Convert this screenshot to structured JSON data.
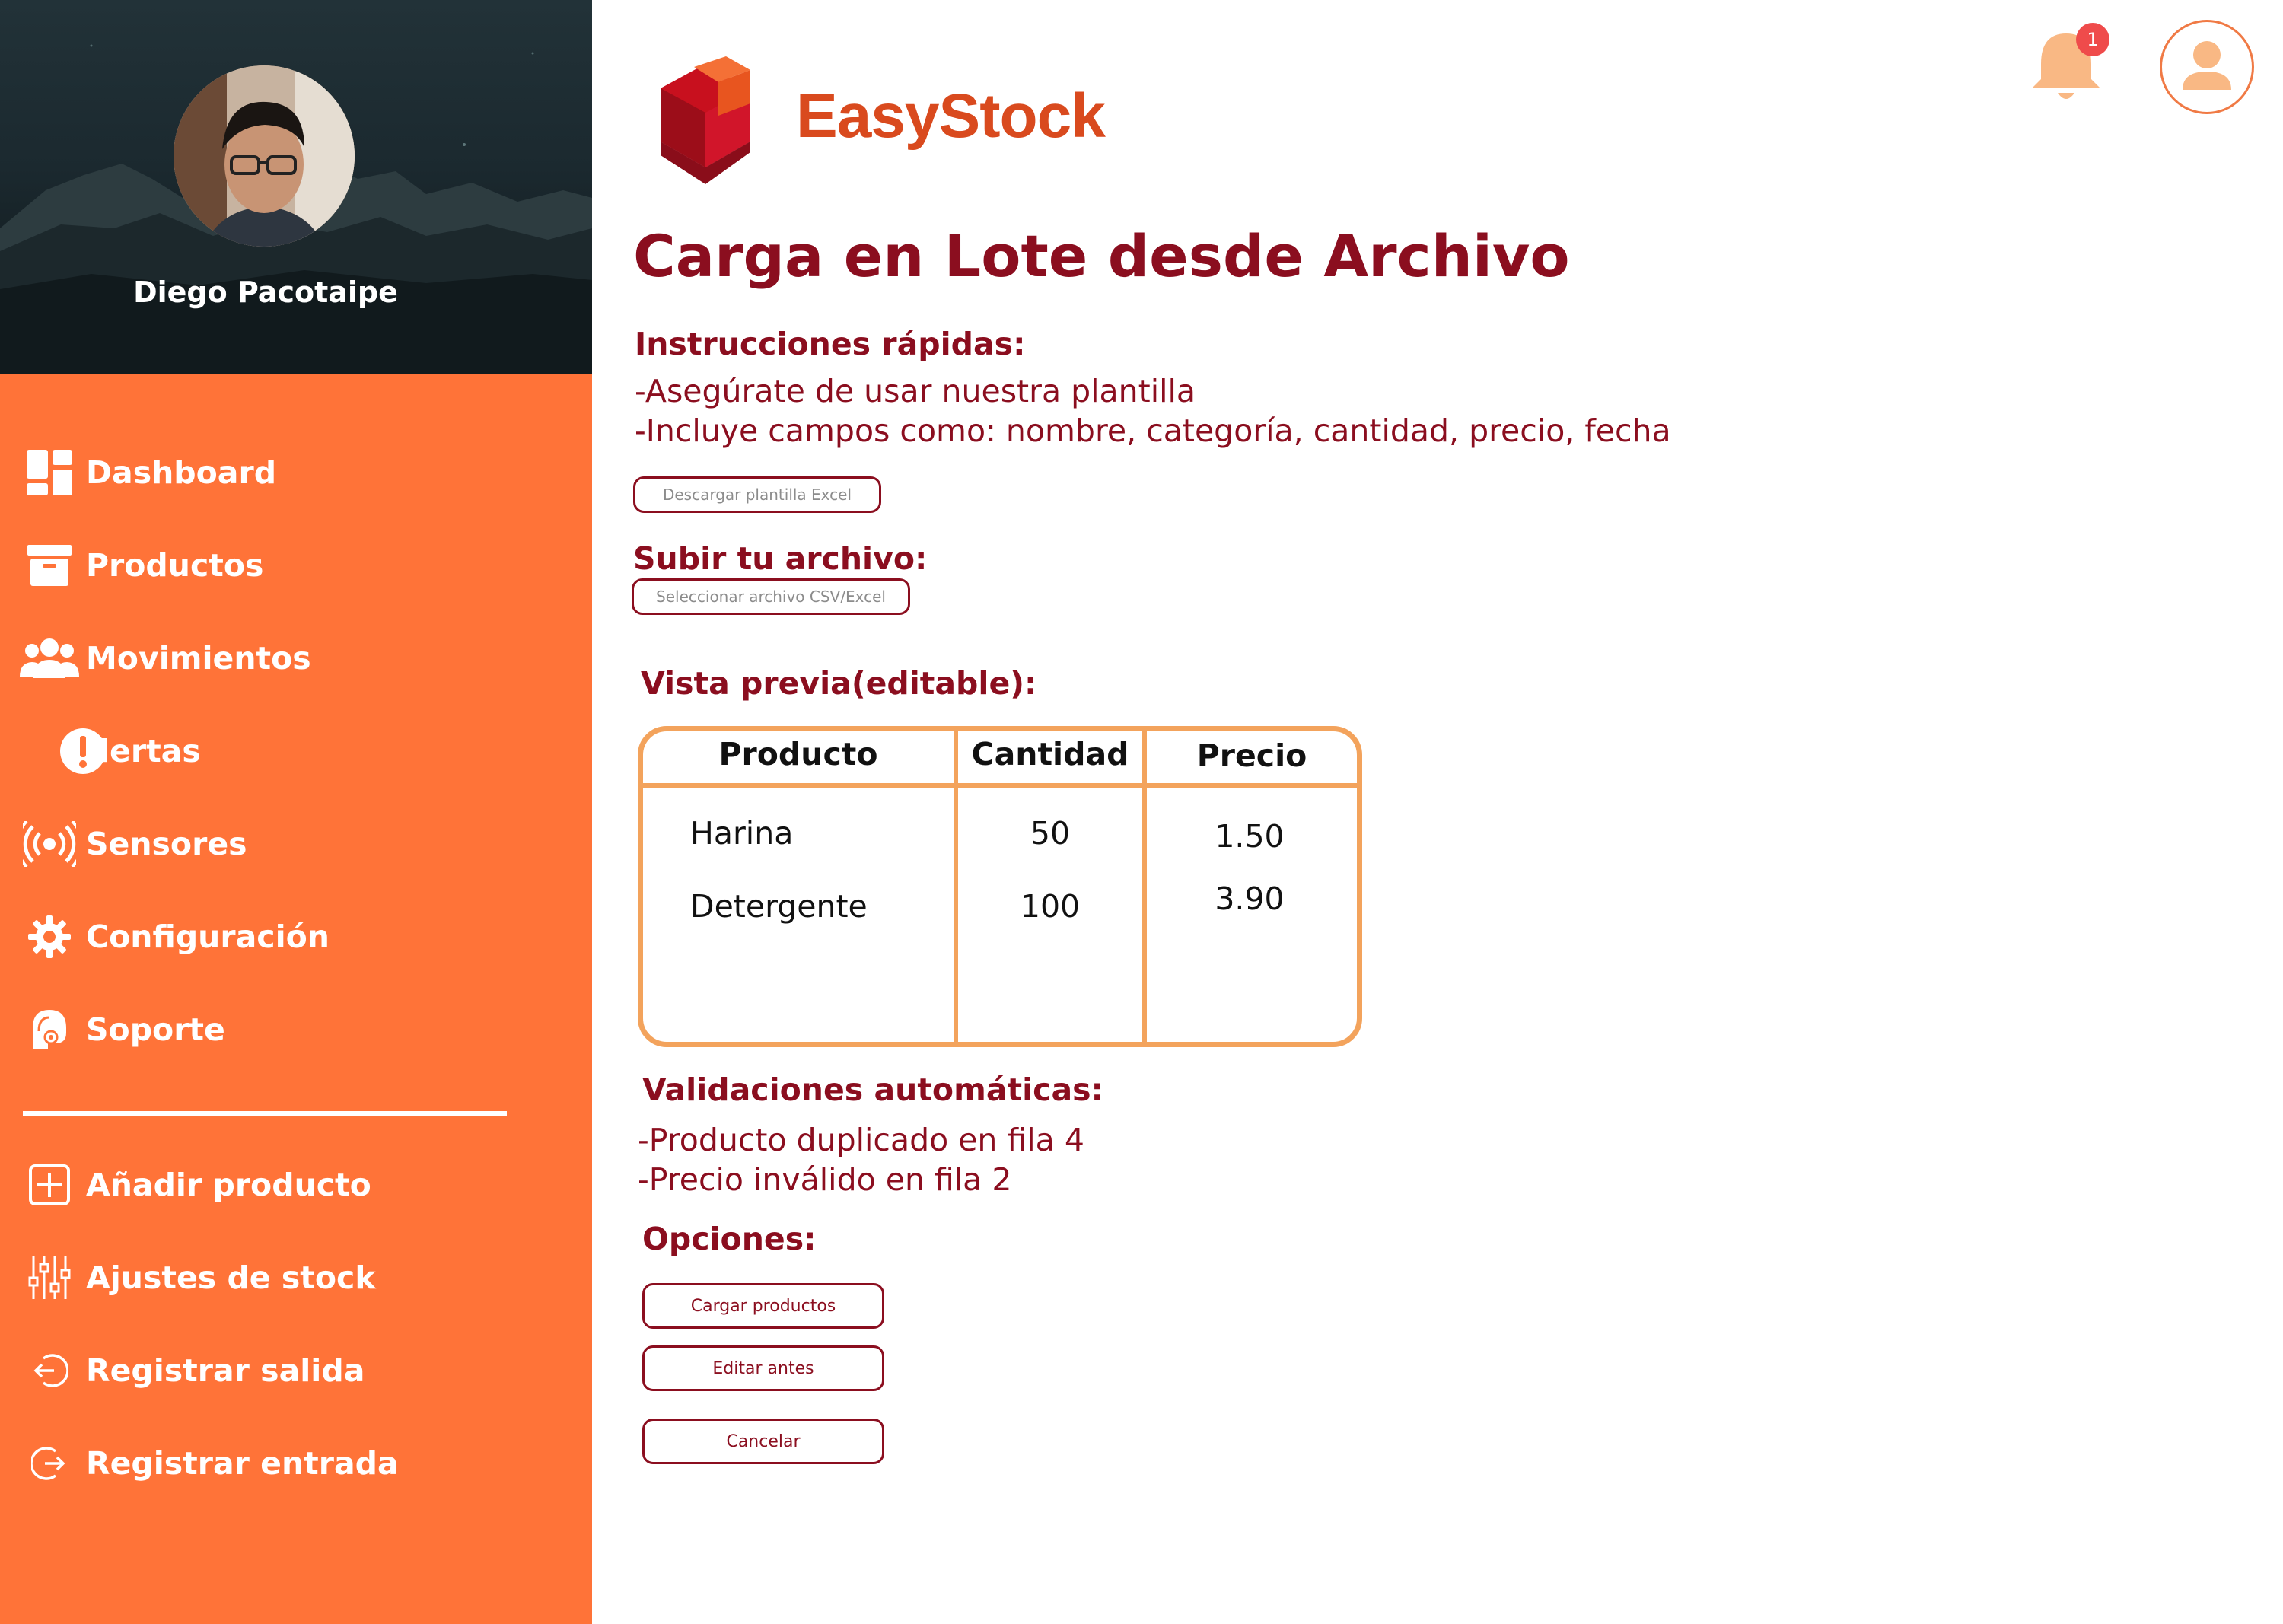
{
  "user": {
    "name": "Diego Pacotaipe"
  },
  "sidebar": {
    "items": [
      {
        "label": "Dashboard",
        "icon": "dashboard-icon"
      },
      {
        "label": "Productos",
        "icon": "archive-box-icon"
      },
      {
        "label": "Movimientos",
        "icon": "users-group-icon"
      },
      {
        "label": "lertas",
        "icon": "alert-circle-icon"
      },
      {
        "label": "Sensores",
        "icon": "sensor-broadcast-icon"
      },
      {
        "label": "Configuración",
        "icon": "gear-icon"
      },
      {
        "label": "Soporte",
        "icon": "support-headset-icon"
      }
    ],
    "actions": [
      {
        "label": "Añadir producto",
        "icon": "plus-square-icon"
      },
      {
        "label": "Ajustes de stock",
        "icon": "sliders-icon"
      },
      {
        "label": "Registrar salida",
        "icon": "logout-arrow-icon"
      },
      {
        "label": "Registrar entrada",
        "icon": "login-arrow-icon"
      }
    ]
  },
  "header": {
    "brand": "EasyStock",
    "notifications_count": "1"
  },
  "page": {
    "title": "Carga en Lote desde Archivo",
    "instructions": {
      "title": "Instrucciones rápidas:",
      "lines": [
        "-Asegúrate de usar nuestra plantilla",
        "-Incluye campos como: nombre, categoría, cantidad, precio, fecha"
      ],
      "download_button": "Descargar plantilla Excel"
    },
    "upload": {
      "title": "Subir tu archivo:",
      "select_button": "Seleccionar archivo CSV/Excel"
    },
    "preview": {
      "title": "Vista previa(editable):",
      "columns": [
        "Producto",
        "Cantidad",
        "Precio"
      ],
      "rows": [
        [
          "Harina",
          "50",
          "1.50"
        ],
        [
          "Detergente",
          "100",
          "3.90"
        ]
      ]
    },
    "validations": {
      "title": "Validaciones automáticas:",
      "lines": [
        "-Producto duplicado en fila 4",
        "-Precio inválido en fila 2"
      ]
    },
    "options": {
      "title": "Opciones:",
      "buttons": [
        "Cargar productos",
        "Editar antes",
        "Cancelar"
      ]
    }
  },
  "colors": {
    "sidebar": "#ff7338",
    "accent_dark_red": "#8b0e1f",
    "brand_orange": "#d94a1e",
    "table_border": "#f3a35c",
    "badge": "#ef4b4b"
  }
}
